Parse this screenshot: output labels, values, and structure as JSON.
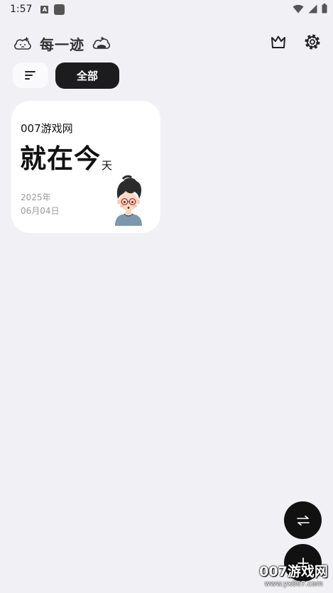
{
  "status_bar": {
    "time": "1:57",
    "badge_letter": "A"
  },
  "header": {
    "title": "每一迹",
    "left_icon": "sad-cloud-icon",
    "right_icon": "happy-cloud-icon",
    "actions": [
      "crown-icon",
      "gear-icon"
    ]
  },
  "filters": {
    "sort_icon": "sort-icon",
    "tabs": [
      {
        "label": "全部",
        "selected": true
      }
    ]
  },
  "cards": [
    {
      "source": "007游戏网",
      "headline_big": "就在今",
      "headline_small": "天",
      "year": "2025年",
      "date": "06月04日",
      "avatar": "boy-with-glasses-avatar"
    }
  ],
  "fabs": [
    "switch-arrows-icon",
    "add-icon"
  ],
  "watermark": {
    "main": "007游戏网",
    "sub": "www.yx007.com"
  },
  "colors": {
    "background": "#f1f0f5",
    "card": "#ffffff",
    "accent": "#1c1c1e",
    "muted_text": "#9a9a9a"
  }
}
